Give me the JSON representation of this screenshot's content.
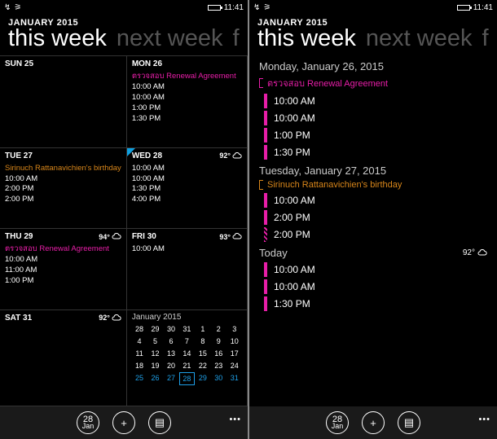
{
  "status": {
    "time": "11:41"
  },
  "header": {
    "monthYear": "JANUARY 2015",
    "pivot": [
      "this week",
      "next week",
      "feb"
    ]
  },
  "left": {
    "days": [
      {
        "label": "SUN 25",
        "events": []
      },
      {
        "label": "MON 26",
        "events": [
          {
            "text": "ตรวจสอบ Renewal Agreement",
            "color": "pink"
          },
          {
            "text": "10:00 AM",
            "color": "white"
          },
          {
            "text": "10:00 AM",
            "color": "white"
          },
          {
            "text": "1:00 PM",
            "color": "white"
          },
          {
            "text": "1:30 PM",
            "color": "white"
          }
        ]
      },
      {
        "label": "TUE 27",
        "events": [
          {
            "text": "Sirinuch Rattanavichien's birthday",
            "color": "orange"
          },
          {
            "text": "10:00 AM",
            "color": "white"
          },
          {
            "text": "2:00 PM",
            "color": "white"
          },
          {
            "text": "2:00 PM",
            "color": "white"
          }
        ]
      },
      {
        "label": "WED 28",
        "today": true,
        "temp": "92°",
        "events": [
          {
            "text": "10:00 AM",
            "color": "white"
          },
          {
            "text": "10:00 AM",
            "color": "white"
          },
          {
            "text": "1:30 PM",
            "color": "white"
          },
          {
            "text": "4:00 PM",
            "color": "white"
          }
        ]
      },
      {
        "label": "THU 29",
        "temp": "94°",
        "events": [
          {
            "text": "ตรวจสอบ Renewal Agreement",
            "color": "pink"
          },
          {
            "text": "10:00 AM",
            "color": "white"
          },
          {
            "text": "11:00 AM",
            "color": "white"
          },
          {
            "text": "1:00 PM",
            "color": "white"
          }
        ]
      },
      {
        "label": "FRI 30",
        "temp": "93°",
        "events": [
          {
            "text": "10:00 AM",
            "color": "white"
          }
        ]
      },
      {
        "label": "SAT 31",
        "temp": "92°",
        "events": []
      }
    ],
    "miniMonth": {
      "title": "January 2015",
      "rows": [
        [
          "28",
          "29",
          "30",
          "31",
          "1",
          "2",
          "3"
        ],
        [
          "4",
          "5",
          "6",
          "7",
          "8",
          "9",
          "10"
        ],
        [
          "11",
          "12",
          "13",
          "14",
          "15",
          "16",
          "17"
        ],
        [
          "18",
          "19",
          "20",
          "21",
          "22",
          "23",
          "24"
        ],
        [
          "25",
          "26",
          "27",
          "28",
          "29",
          "30",
          "31"
        ]
      ],
      "blueRow": 4,
      "todayCol": 3
    }
  },
  "right": {
    "days": [
      {
        "title": "Monday, January 26, 2015",
        "header": {
          "text": "ตรวจสอบ Renewal Agreement",
          "color": "pink"
        },
        "items": [
          {
            "t": "10:00 AM"
          },
          {
            "t": "10:00 AM"
          },
          {
            "t": "1:00 PM"
          },
          {
            "t": "1:30 PM"
          }
        ]
      },
      {
        "title": "Tuesday, January 27, 2015",
        "header": {
          "text": "Sirinuch Rattanavichien's birthday",
          "color": "orange"
        },
        "items": [
          {
            "t": "10:00 AM"
          },
          {
            "t": "2:00 PM"
          },
          {
            "t": "2:00 PM",
            "striped": true
          }
        ]
      },
      {
        "title": "Today",
        "temp": "92°",
        "items": [
          {
            "t": "10:00 AM"
          },
          {
            "t": "10:00 AM"
          },
          {
            "t": "1:30 PM"
          }
        ]
      }
    ]
  },
  "appbar": {
    "dayNum": "28",
    "dayMon": "Jan"
  }
}
